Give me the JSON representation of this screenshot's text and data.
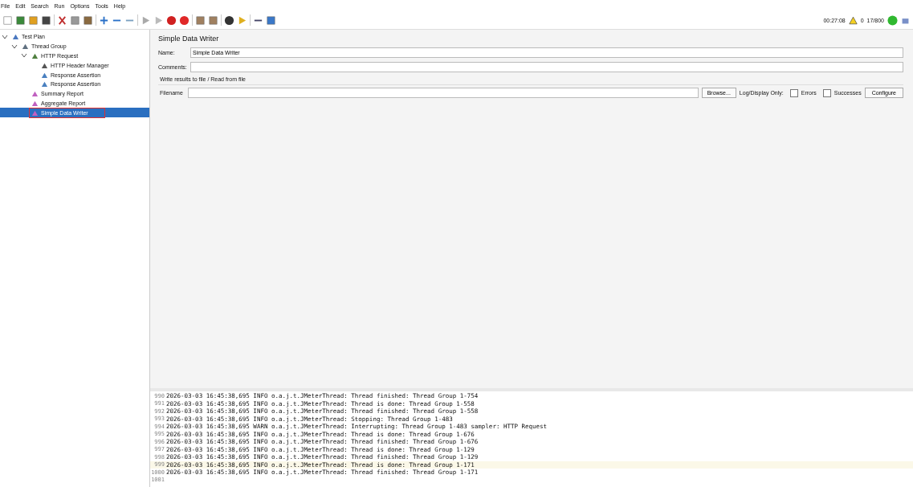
{
  "menu": [
    "File",
    "Edit",
    "Search",
    "Run",
    "Options",
    "Tools",
    "Help"
  ],
  "status": {
    "elapsed": "00:27:08",
    "warnings": "0",
    "threads": "17/800",
    "running": true
  },
  "tree": [
    {
      "label": "Test Plan",
      "kind": "plan",
      "expanded": true,
      "selected": false,
      "outlined": false,
      "children": [
        {
          "label": "Thread Group",
          "kind": "group",
          "expanded": true,
          "selected": false,
          "outlined": false,
          "children": [
            {
              "label": "HTTP Request",
              "kind": "sampler",
              "expanded": true,
              "selected": false,
              "outlined": false,
              "children": [
                {
                  "label": "HTTP Header Manager",
                  "kind": "config",
                  "selected": false,
                  "outlined": false
                },
                {
                  "label": "Response Assertion",
                  "kind": "assertion",
                  "selected": false,
                  "outlined": false
                },
                {
                  "label": "Response Assertion",
                  "kind": "assertion",
                  "selected": false,
                  "outlined": false
                }
              ]
            },
            {
              "label": "Summary Report",
              "kind": "listener",
              "selected": false,
              "outlined": false
            },
            {
              "label": "Aggregate Report",
              "kind": "listener",
              "selected": false,
              "outlined": false
            },
            {
              "label": "Simple Data Writer",
              "kind": "listener",
              "selected": true,
              "outlined": true
            }
          ]
        }
      ]
    }
  ],
  "panel": {
    "title": "Simple Data Writer",
    "name_label": "Name:",
    "name_value": "Simple Data Writer",
    "comments_label": "Comments:",
    "section": "Write results to file / Read from file",
    "filename_label": "Filename",
    "browse": "Browse...",
    "log_only": "Log/Display Only:",
    "errors": {
      "label": "Errors",
      "checked": false
    },
    "successes": {
      "label": "Successes",
      "checked": false
    },
    "configure": "Configure"
  },
  "log": [
    {
      "num": "990",
      "text": "2026-03-03 16:45:38,695 INFO o.a.j.t.JMeterThread: Thread finished: Thread Group 1-754",
      "highlighted": false
    },
    {
      "num": "991",
      "text": "2026-03-03 16:45:38,695 INFO o.a.j.t.JMeterThread: Thread is done: Thread Group 1-558",
      "highlighted": false
    },
    {
      "num": "992",
      "text": "2026-03-03 16:45:38,695 INFO o.a.j.t.JMeterThread: Thread finished: Thread Group 1-558",
      "highlighted": false
    },
    {
      "num": "993",
      "text": "2026-03-03 16:45:38,695 INFO o.a.j.t.JMeterThread: Stopping: Thread Group 1-483",
      "highlighted": false
    },
    {
      "num": "994",
      "text": "2026-03-03 16:45:38,695 WARN o.a.j.t.JMeterThread: Interrupting: Thread Group 1-483 sampler: HTTP Request",
      "highlighted": false
    },
    {
      "num": "995",
      "text": "2026-03-03 16:45:38,695 INFO o.a.j.t.JMeterThread: Thread is done: Thread Group 1-676",
      "highlighted": false
    },
    {
      "num": "996",
      "text": "2026-03-03 16:45:38,695 INFO o.a.j.t.JMeterThread: Thread finished: Thread Group 1-676",
      "highlighted": false
    },
    {
      "num": "997",
      "text": "2026-03-03 16:45:38,695 INFO o.a.j.t.JMeterThread: Thread is done: Thread Group 1-129",
      "highlighted": false
    },
    {
      "num": "998",
      "text": "2026-03-03 16:45:38,695 INFO o.a.j.t.JMeterThread: Thread finished: Thread Group 1-129",
      "highlighted": false
    },
    {
      "num": "999",
      "text": "2026-03-03 16:45:38,695 INFO o.a.j.t.JMeterThread: Thread is done: Thread Group 1-171",
      "highlighted": true
    },
    {
      "num": "1000",
      "text": "2026-03-03 16:45:38,695 INFO o.a.j.t.JMeterThread: Thread finished: Thread Group 1-171",
      "highlighted": false
    },
    {
      "num": "1001",
      "highlighted": false
    }
  ]
}
